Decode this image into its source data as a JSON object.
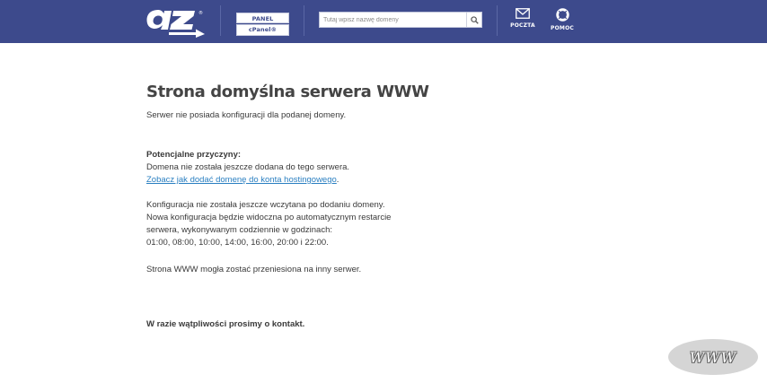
{
  "header": {
    "panel_label": "PANEL KLIENTA",
    "cpanel_label": "cPanel®",
    "search_placeholder": "Tutaj wpisz nazwę domeny",
    "mail_label": "POCZTA",
    "help_label": "POMOC",
    "bg_color": "#3d4a8c"
  },
  "main": {
    "title": "Strona domyślna serwera WWW",
    "intro": "Serwer nie posiada konfiguracji dla podanej domeny.",
    "causes_heading": "Potencjalne przyczyny:",
    "cause1": "Domena nie została jeszcze dodana do tego serwera.",
    "cause1_link": "Zobacz jak dodać domenę do konta hostingowego",
    "cause1_link_suffix": ".",
    "cause2_lines": [
      "Konfiguracja nie została jeszcze wczytana po dodaniu domeny.",
      "Nowa konfiguracja będzie widoczna po automatycznym restarcie",
      "serwera, wykonywanym codziennie w godzinach:",
      "01:00, 08:00, 10:00, 14:00, 16:00, 20:00 i 22:00."
    ],
    "cause3": "Strona WWW mogła zostać przeniesiona na inny serwer.",
    "contact": "W razie wątpliwości prosimy o kontakt."
  },
  "badge": {
    "text": "WWW"
  },
  "icons": [
    "az-logo",
    "search-icon",
    "mail-icon",
    "lifebuoy-icon"
  ]
}
